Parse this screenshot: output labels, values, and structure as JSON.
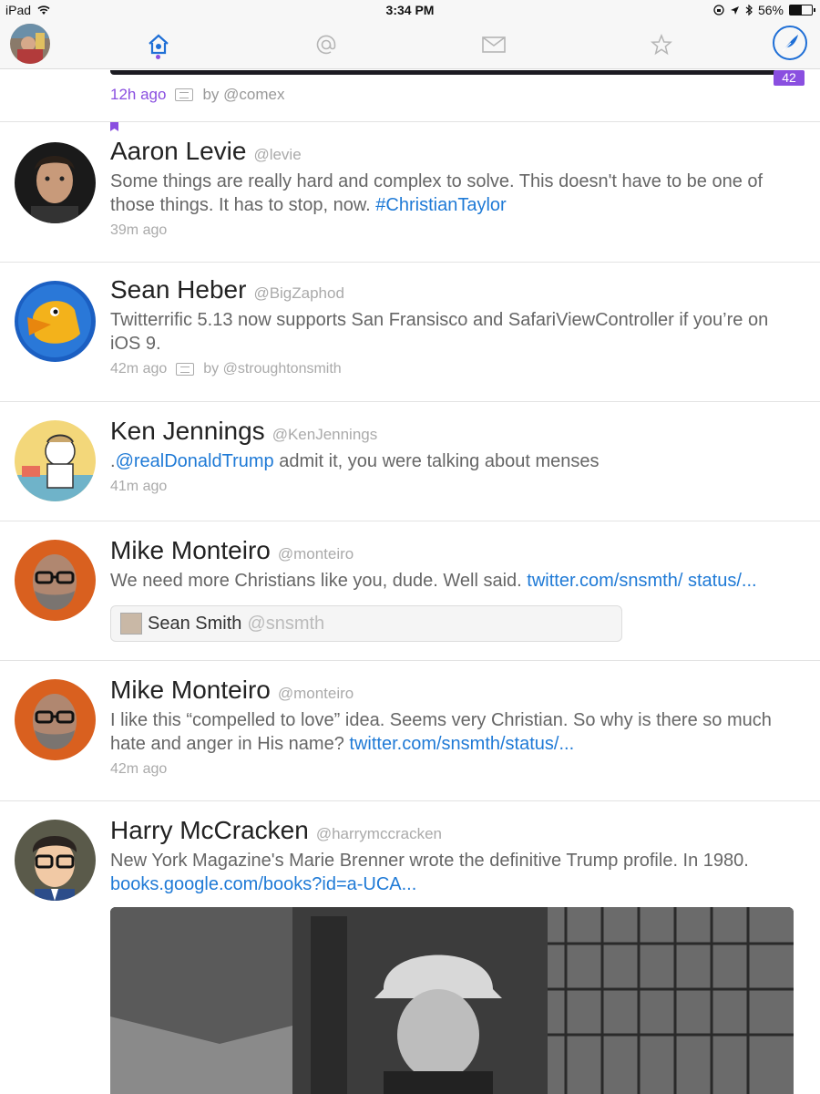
{
  "status_bar": {
    "device": "iPad",
    "time": "3:34 PM",
    "battery_percent_label": "56%",
    "battery_level": 0.56
  },
  "nav": {
    "tabs": [
      {
        "icon": "home-icon",
        "active": true
      },
      {
        "icon": "at-mention-icon",
        "active": false
      },
      {
        "icon": "mail-icon",
        "active": false
      },
      {
        "icon": "star-icon",
        "active": false
      }
    ],
    "accent_color": "#8a4fe0",
    "compose_color": "#1f6fd6"
  },
  "previous_tweet": {
    "time": "12h ago",
    "retweet_by": "by @comex",
    "badge": "42"
  },
  "tweets": [
    {
      "name": "Aaron Levie",
      "handle": "@levie",
      "text": "Some things are really hard and complex to solve. This doesn't have to be one of those things. It has to stop, now. ",
      "link": "#ChristianTaylor",
      "time": "39m ago"
    },
    {
      "name": "Sean Heber",
      "handle": "@BigZaphod",
      "text": "Twitterrific 5.13 now supports San Fransisco and SafariViewController if you’re on iOS 9.",
      "time": "42m ago",
      "retweet_by": "by @stroughtonsmith"
    },
    {
      "name": "Ken Jennings",
      "handle": "@KenJennings",
      "prefix": ".",
      "link": "@realDonaldTrump",
      "text": " admit it, you were talking about menses",
      "time": "41m ago"
    },
    {
      "name": "Mike Monteiro",
      "handle": "@monteiro",
      "text": "We need more Christians like you, dude. Well said. ",
      "link": "twitter.com/snsmth/ status/...",
      "quote": {
        "name": "Sean Smith",
        "handle": "@snsmth"
      }
    },
    {
      "name": "Mike Monteiro",
      "handle": "@monteiro",
      "text": "I like this “compelled to love” idea. Seems very Christian. So why is there so much hate and anger in His name? ",
      "link": "twitter.com/snsmth/status/...",
      "time": "42m ago"
    },
    {
      "name": "Harry McCracken",
      "handle": "@harrymccracken",
      "text": "New York Magazine's Marie Brenner wrote the definitive Trump profile. In 1980. ",
      "link": "books.google.com/books?id=a-UCA..."
    }
  ]
}
